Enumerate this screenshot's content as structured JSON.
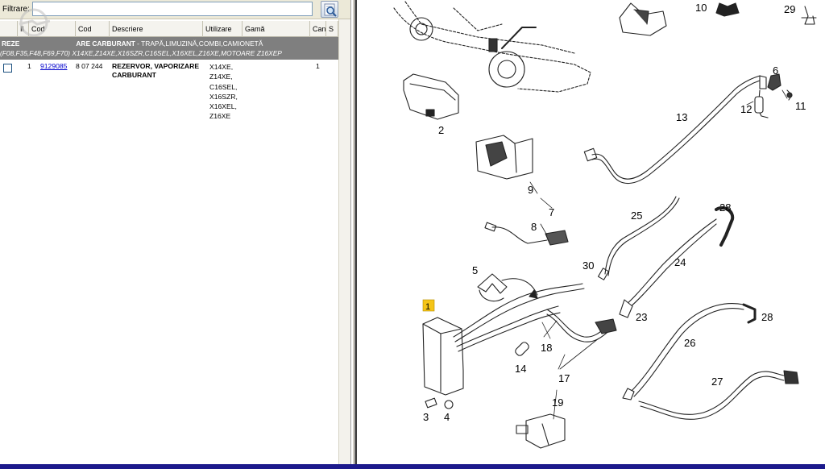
{
  "filter": {
    "label": "Filtrare:",
    "value": "",
    "search_icon": "search-icon"
  },
  "watermark": {
    "text": "clubOpel.com"
  },
  "columns": [
    {
      "label": ""
    },
    {
      "label": "Il"
    },
    {
      "label": "Cod"
    },
    {
      "label": "Cod"
    },
    {
      "label": "Descriere"
    },
    {
      "label": "Utilizare"
    },
    {
      "label": "Gamă"
    },
    {
      "label": "Can"
    },
    {
      "label": "S"
    }
  ],
  "group": {
    "title": "REZERVOR, VAPORIZARE CARBURANT",
    "title_prefix": "REZE",
    "line1_rest": " - TRAPĂ,LIMUZINĂ,COMBI,CAMIONETĂ",
    "line2": "(F08,F35,F48,F69,F70) X14XE,Z14XE,X16SZR,C16SEL,X16XEL,Z16XE,MOTOARE Z16XEP"
  },
  "parts": [
    {
      "pos": "1",
      "part_no": "9129085",
      "cod": "8 07 244",
      "description": "REZERVOR, VAPORIZARE CARBURANT",
      "usage": [
        "X14XE,",
        "Z14XE,",
        "C16SEL,",
        "X16SZR,",
        "X16XEL,",
        "Z16XE"
      ],
      "qty": "1"
    }
  ],
  "diagram": {
    "labels": [
      "1",
      "2",
      "3",
      "4",
      "5",
      "6",
      "7",
      "8",
      "9",
      "10",
      "11",
      "12",
      "13",
      "14",
      "17",
      "18",
      "19",
      "23",
      "24",
      "25",
      "26",
      "27",
      "28",
      "28",
      "29",
      "30"
    ],
    "highlight_label": "1",
    "highlight_color": "#f5c518"
  },
  "colors": {
    "group_bg": "#7f7f7f",
    "link": "#0000cc",
    "bottom_bar": "#1c1a8c"
  }
}
